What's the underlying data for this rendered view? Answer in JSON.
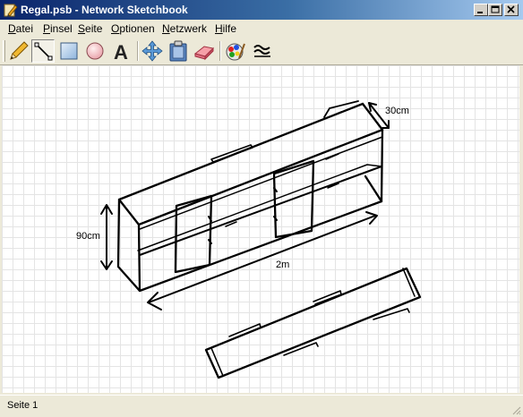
{
  "window": {
    "title": "Regal.psb - Network Sketchbook"
  },
  "menu": [
    {
      "label": "Datei"
    },
    {
      "label": "Pinsel"
    },
    {
      "label": "Seite"
    },
    {
      "label": "Optionen"
    },
    {
      "label": "Netzwerk"
    },
    {
      "label": "Hilfe"
    }
  ],
  "toolbar": {
    "tools": [
      "pencil-icon",
      "line-icon",
      "rectangle-icon",
      "ellipse-icon",
      "text-tool-icon",
      "move-icon",
      "clipboard-icon",
      "eraser-icon",
      "color-palette-icon",
      "line-style-icon"
    ],
    "active_tool": "line-icon",
    "text_tool_glyph": "A"
  },
  "canvas": {
    "dimension_labels": {
      "depth": "30cm",
      "height": "90cm",
      "width": "2m"
    }
  },
  "status": {
    "page": "Seite 1"
  },
  "colors": {
    "title_start": "#0A246A",
    "title_end": "#A6CAF0",
    "chrome": "#ECE9D8",
    "grid": "#E4E4E4"
  }
}
